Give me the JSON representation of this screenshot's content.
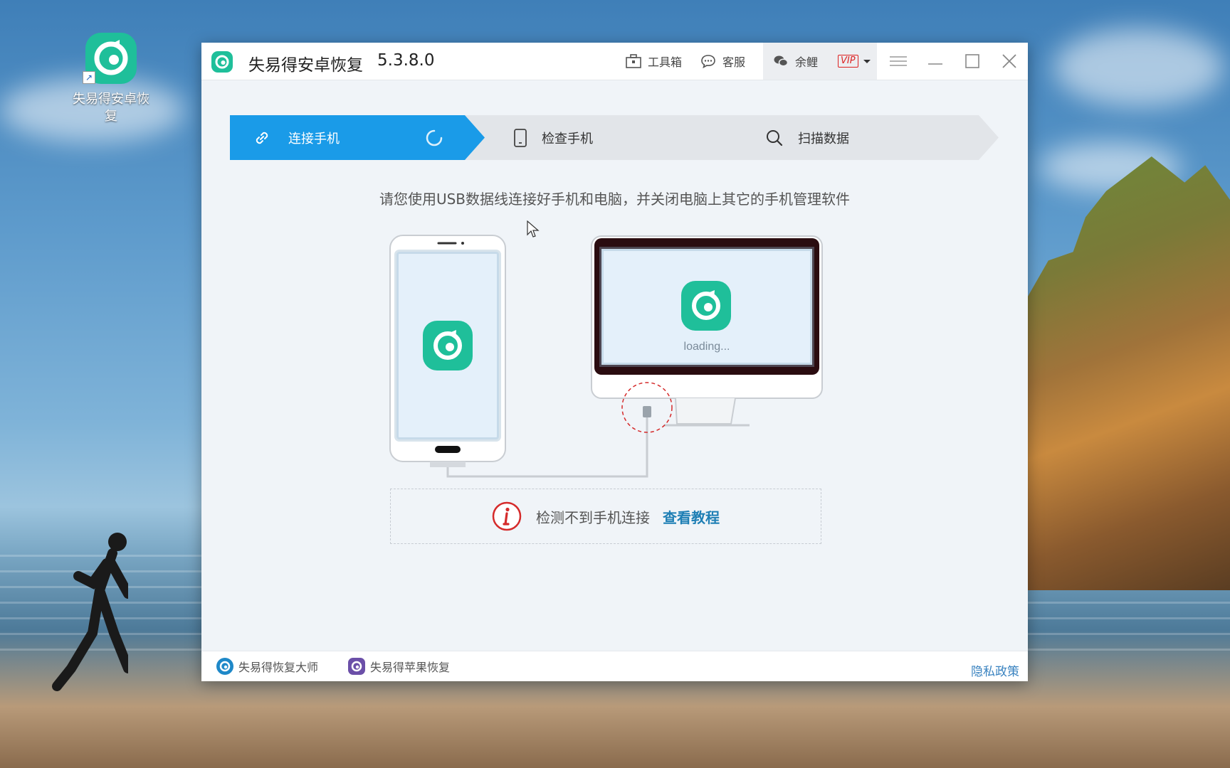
{
  "desktop": {
    "icon_label": "失易得安卓恢复",
    "shortcut_glyph": "↗"
  },
  "window": {
    "title": "失易得安卓恢复",
    "version": "5.3.8.0",
    "toolbox_label": "工具箱",
    "service_label": "客服",
    "username": "余鲤",
    "vip_label": "VIP"
  },
  "steps": [
    {
      "label": "连接手机",
      "state": "active",
      "icon": "link-icon"
    },
    {
      "label": "检查手机",
      "state": "pending",
      "icon": "phone-icon"
    },
    {
      "label": "扫描数据",
      "state": "pending",
      "icon": "search-icon"
    }
  ],
  "instruction": "请您使用USB数据线连接好手机和电脑，并关闭电脑上其它的手机管理软件",
  "monitor": {
    "loading_text": "loading..."
  },
  "notice": {
    "message": "检测不到手机连接",
    "link": "查看教程"
  },
  "footer": {
    "link1": "失易得恢复大师",
    "link2": "失易得苹果恢复",
    "privacy": "隐私政策"
  },
  "colors": {
    "accent": "#1a9be8",
    "brand_green": "#1fbf9a",
    "warning": "#d52b2b",
    "link": "#1f7fb5"
  }
}
